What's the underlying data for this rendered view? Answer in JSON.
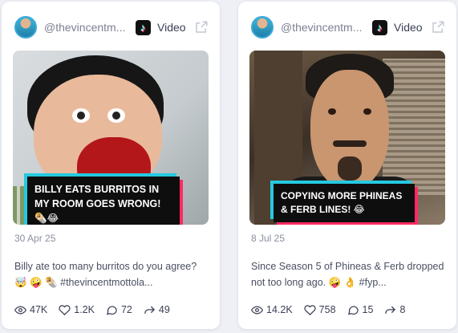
{
  "cards": [
    {
      "handle": "@thevincentm...",
      "platform_icon": "tiktok-icon",
      "type_label": "Video",
      "caption_overlay": "BILLY EATS BURRITOS IN MY ROOM GOES WRONG! 🌯😂",
      "date": "30 Apr 25",
      "description": "Billy ate too many burritos do you agree? 🤯 🤪 🌯 #thevincentmottola...",
      "stats": {
        "views": "47K",
        "likes": "1.2K",
        "comments": "72",
        "shares": "49"
      }
    },
    {
      "handle": "@thevincentm...",
      "platform_icon": "tiktok-icon",
      "type_label": "Video",
      "caption_overlay": "COPYING MORE PHINEAS & FERB LINES! 😂",
      "date": "8 Jul 25",
      "description": "Since Season 5 of Phineas & Ferb dropped not too long ago. 🤪 👌 #fyp...",
      "stats": {
        "views": "14.2K",
        "likes": "758",
        "comments": "15",
        "shares": "8"
      }
    }
  ],
  "colors": {
    "accent_cyan": "#25c9e0",
    "accent_pink": "#ff2a64",
    "card_bg": "#ffffff",
    "page_bg": "#eef0f5"
  }
}
